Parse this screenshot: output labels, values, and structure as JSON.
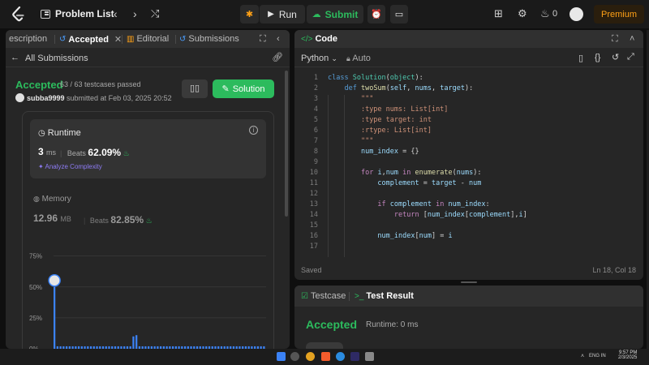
{
  "topbar": {
    "problem_list": "Problem List",
    "run_label": "Run",
    "submit_label": "Submit",
    "streak_count": "0",
    "premium_label": "Premium"
  },
  "left": {
    "tabs": [
      {
        "label": "escription"
      },
      {
        "label": "Accepted"
      },
      {
        "label": "Editorial"
      },
      {
        "label": "Submissions"
      }
    ],
    "back_label": "All Submissions",
    "status": "Accepted",
    "testcases": "63 / 63 testcases passed",
    "username": "subba9999",
    "submitted_text": "submitted at Feb 03, 2025 20:52",
    "solution_label": "Solution",
    "runtime": {
      "label": "Runtime",
      "value": "3",
      "unit": "ms",
      "beats_label": "Beats",
      "beats_pct": "62.09%",
      "analyze_label": "Analyze Complexity"
    },
    "memory": {
      "label": "Memory",
      "value": "12.96",
      "unit": "MB",
      "beats_label": "Beats",
      "beats_pct": "82.85%"
    }
  },
  "chart_data": {
    "type": "bar",
    "ytick_labels": [
      "75%",
      "50%",
      "25%",
      "0%"
    ],
    "yticks": [
      75,
      50,
      25,
      0
    ],
    "ylim": [
      0,
      80
    ],
    "values": [
      50,
      2,
      2,
      2,
      2,
      2,
      2,
      2,
      2,
      2,
      2,
      2,
      2,
      2,
      2,
      2,
      2,
      2,
      2,
      2,
      2,
      2,
      2,
      2,
      2,
      2,
      10,
      11,
      2,
      2,
      2,
      2,
      2,
      2,
      2,
      2,
      2,
      2,
      2,
      2,
      2,
      2,
      2,
      2,
      2,
      2,
      2,
      2,
      2,
      2,
      2,
      2,
      2,
      2,
      2,
      2,
      2,
      2,
      2,
      2,
      2,
      2,
      2,
      2,
      2,
      2,
      2,
      2,
      2,
      2
    ],
    "highlight_index": 0,
    "bar_color": "#3b82f6"
  },
  "code": {
    "tab_label": "Code",
    "language": "Python",
    "mode": "Auto",
    "status": "Saved",
    "cursor": "Ln 18, Col 18",
    "line_numbers": [
      "1",
      "2",
      "3",
      "4",
      "5",
      "6",
      "7",
      "8",
      "9",
      "10",
      "11",
      "12",
      "13",
      "14",
      "15",
      "16",
      "17"
    ]
  },
  "test": {
    "testcase_label": "Testcase",
    "result_label": "Test Result",
    "status": "Accepted",
    "runtime": "Runtime: 0 ms"
  },
  "taskbar": {
    "time": "9:57 PM",
    "date": "2/3/2025",
    "lang": "ENG IN"
  },
  "colors": {
    "accent_green": "#2cbb5d",
    "premium_orange": "#ffa116",
    "analyze_purple": "#8e7cf5"
  }
}
